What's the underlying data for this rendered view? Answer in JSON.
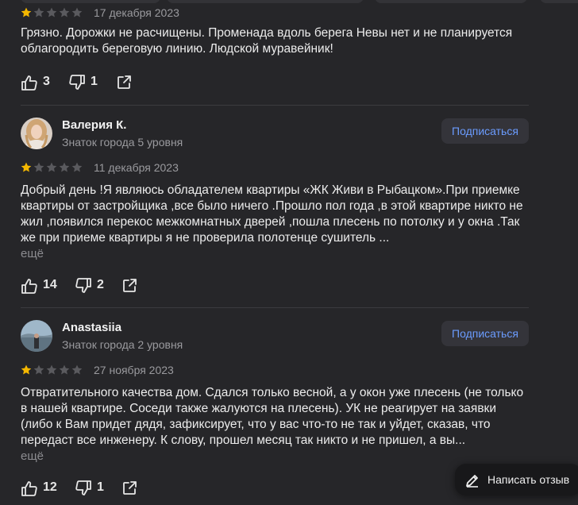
{
  "reviews": [
    {
      "date": "17 декабря 2023",
      "rating": 1,
      "text": "Грязно. Дорожки не расчищены. Променада вдоль берега Невы нет и не планируется облагородить береговую линию. Людской муравейник!",
      "likes": "3",
      "dislikes": "1"
    },
    {
      "author": "Валерия К.",
      "level": "Знаток города 5 уровня",
      "subscribe": "Подписаться",
      "date": "11 декабря 2023",
      "rating": 1,
      "text": "Добрый день !Я являюсь обладателем квартиры «ЖК Живи в Рыбацком».При приемке квартиры от застройщика ,все было ничего .Прошло пол года ,в этой квартире никто не жил ,появился перекос межкомнатных дверей ,пошла плесень по потолку и у окна .Так же при приеме квартиры я не проверила полотенце сушитель ...",
      "more": "ещё",
      "likes": "14",
      "dislikes": "2"
    },
    {
      "author": "Anastasiia",
      "level": "Знаток города 2 уровня",
      "subscribe": "Подписаться",
      "date": "27 ноября 2023",
      "rating": 1,
      "text": "Отвратительного качества дом. Сдался только весной, а у окон уже плесень (не только в нашей квартире. Соседи также жалуются на плесень). УК не реагирует на заявки (либо к Вам придет дядя, зафиксирует, что у вас что-то не так и уйдет, сказав, что передаст все инженеру. К слову, прошел месяц так никто и не пришел, а вы...",
      "more": "ещё",
      "likes": "12",
      "dislikes": "1"
    }
  ],
  "write_review": "Написать отзыв",
  "colors": {
    "background": "#262629",
    "star_filled": "#f5b800",
    "star_empty": "#5a5a5e",
    "accent": "#6b9cff"
  }
}
